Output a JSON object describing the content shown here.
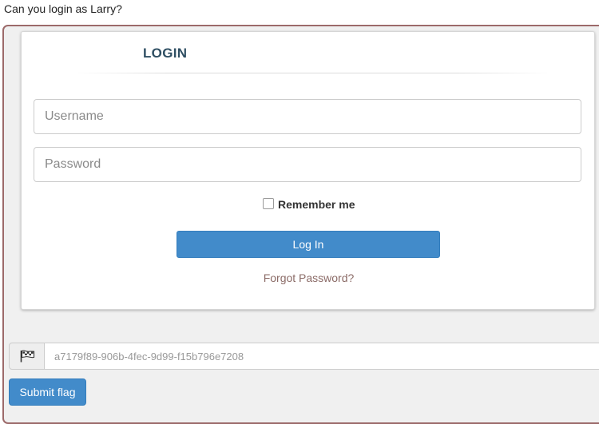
{
  "challenge": {
    "question": "Can you login as Larry?"
  },
  "login": {
    "title": "LOGIN",
    "username_placeholder": "Username",
    "password_placeholder": "Password",
    "remember_label": "Remember me",
    "remember_checked": false,
    "login_button": "Log In",
    "forgot_link": "Forgot Password?"
  },
  "flag": {
    "icon": "flag-icon",
    "placeholder": "a7179f89-906b-4fec-9d99-f15b796e7208",
    "submit_label": "Submit flag"
  },
  "colors": {
    "primary_button": "#428bca",
    "frame_border": "#9c6a6a",
    "title": "#2f4f63",
    "forgot_link": "#8b6b67"
  }
}
